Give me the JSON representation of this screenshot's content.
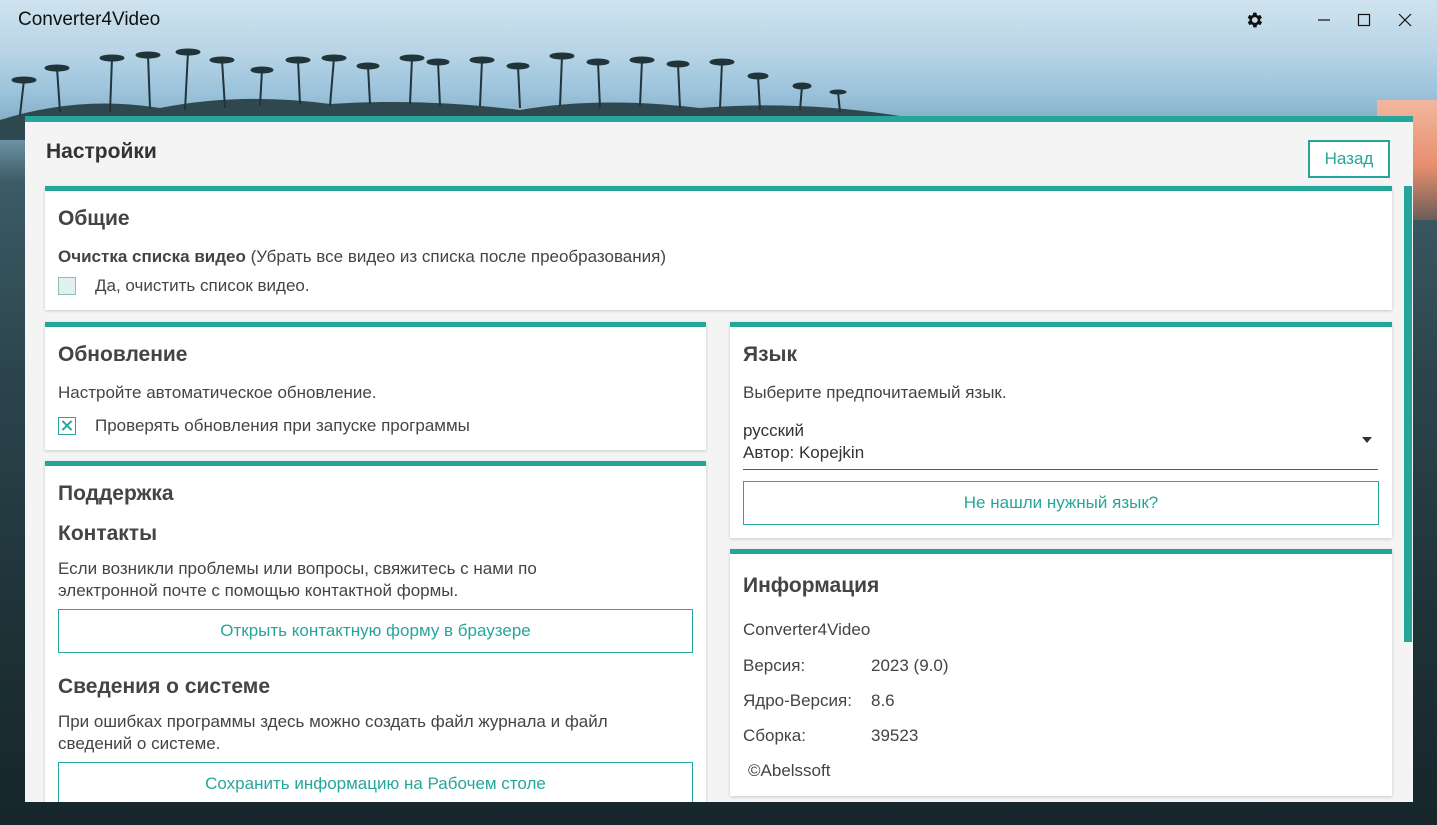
{
  "window": {
    "title": "Converter4Video"
  },
  "page": {
    "title": "Настройки",
    "back_label": "Назад"
  },
  "general": {
    "title": "Общие",
    "option_label_bold": "Очистка списка видео",
    "option_label_rest": " (Убрать все видео из списка после преобразования)",
    "checkbox_label": "Да, очистить список видео.",
    "checked": false
  },
  "update": {
    "title": "Обновление",
    "description": "Настройте автоматическое обновление.",
    "checkbox_label": "Проверять обновления при запуске программы",
    "checked": true
  },
  "support": {
    "title": "Поддержка",
    "contacts_title": "Контакты",
    "contacts_text_1": "Если возникли проблемы или вопросы, свяжитесь с нами по",
    "contacts_text_2": "электронной почте с помощью контактной формы.",
    "contact_button": "Открыть контактную форму в браузере",
    "sysinfo_title": "Сведения о системе",
    "sysinfo_text_1": "При ошибках программы здесь можно создать файл журнала и файл",
    "sysinfo_text_2": "сведений о системе.",
    "sysinfo_button": "Сохранить информацию на Рабочем столе"
  },
  "language": {
    "title": "Язык",
    "description": "Выберите предпочитаемый язык.",
    "selected_language": "русский",
    "selected_author": "Автор: Kopejkin",
    "missing_button": "Не нашли нужный язык?"
  },
  "info": {
    "title": "Информация",
    "product": "Converter4Video",
    "version_label": "Версия:",
    "version_value": "2023 (9.0)",
    "core_label": "Ядро-Версия:",
    "core_value": "8.6",
    "build_label": "Сборка:",
    "build_value": "39523",
    "copyright": "©Abelssoft"
  },
  "colors": {
    "accent": "#26a69a"
  }
}
